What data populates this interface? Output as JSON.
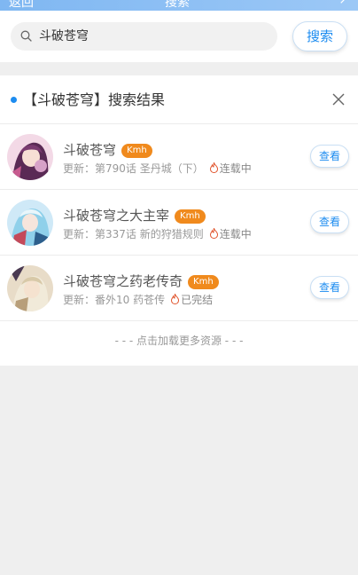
{
  "topbar": {
    "back_label": "返回",
    "title": "搜索",
    "share_label": "↗"
  },
  "search": {
    "query": "斗破苍穹",
    "button_label": "搜索"
  },
  "results": {
    "title": "【斗破苍穹】搜索结果",
    "items": [
      {
        "name": "斗破苍穹",
        "source": "Kmh",
        "update": "更新：第790话 圣丹城（下）",
        "status": "连载中",
        "action": "查看"
      },
      {
        "name": "斗破苍穹之大主宰",
        "source": "Kmh",
        "update": "更新：第337话 新的狩猎规则",
        "status": "连载中",
        "action": "查看"
      },
      {
        "name": "斗破苍穹之药老传奇",
        "source": "Kmh",
        "update": "更新：番外10 药苍传",
        "status": "已完结",
        "action": "查看"
      }
    ],
    "load_more": "- - - 点击加载更多资源 - - -"
  },
  "colors": {
    "accent": "#1d8cf0",
    "badge": "#f08a1d",
    "fire": "#e0522a"
  }
}
